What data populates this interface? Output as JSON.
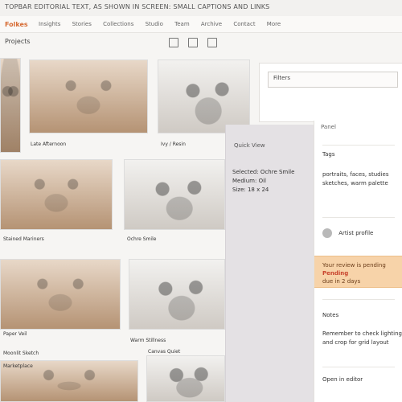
{
  "top_bar": {
    "text": "TOPBAR EDITORIAL TEXT, AS SHOWN IN SCREEN: SMALL CAPTIONS AND LINKS"
  },
  "nav": {
    "brand": "Folkes",
    "items": [
      "Insights",
      "Stories",
      "Collections",
      "Studio",
      "Team",
      "Archive",
      "Contact",
      "More"
    ]
  },
  "toolbar": {
    "label": "Projects"
  },
  "grid": {
    "captions": [
      "Late Afternoon",
      "Ivy / Resin",
      "Stained Mariners",
      "Ochre Smile",
      "Paper Veil",
      "Warm Stillness",
      "Moonlit Sketch",
      "Canvas Quiet",
      "Marketplace"
    ]
  },
  "right_card": {
    "value": "Filters"
  },
  "overlay": {
    "title": "Quick View",
    "lines": [
      "Selected: Ochre Smile",
      "Medium: Oil",
      "Size: 18 x 24"
    ]
  },
  "sidebar": {
    "top": "Panel",
    "section1_title": "Tags",
    "section1_lines": [
      "portraits, faces, studies",
      "sketches, warm palette"
    ],
    "author": "Artist profile",
    "alert_lines": [
      "Your review is pending",
      "due in 2 days"
    ],
    "alert_badge": "Pending",
    "section2_title": "Notes",
    "section2_lines": [
      "Remember to check lighting",
      "and crop for grid layout"
    ],
    "footer": "Open in editor"
  }
}
